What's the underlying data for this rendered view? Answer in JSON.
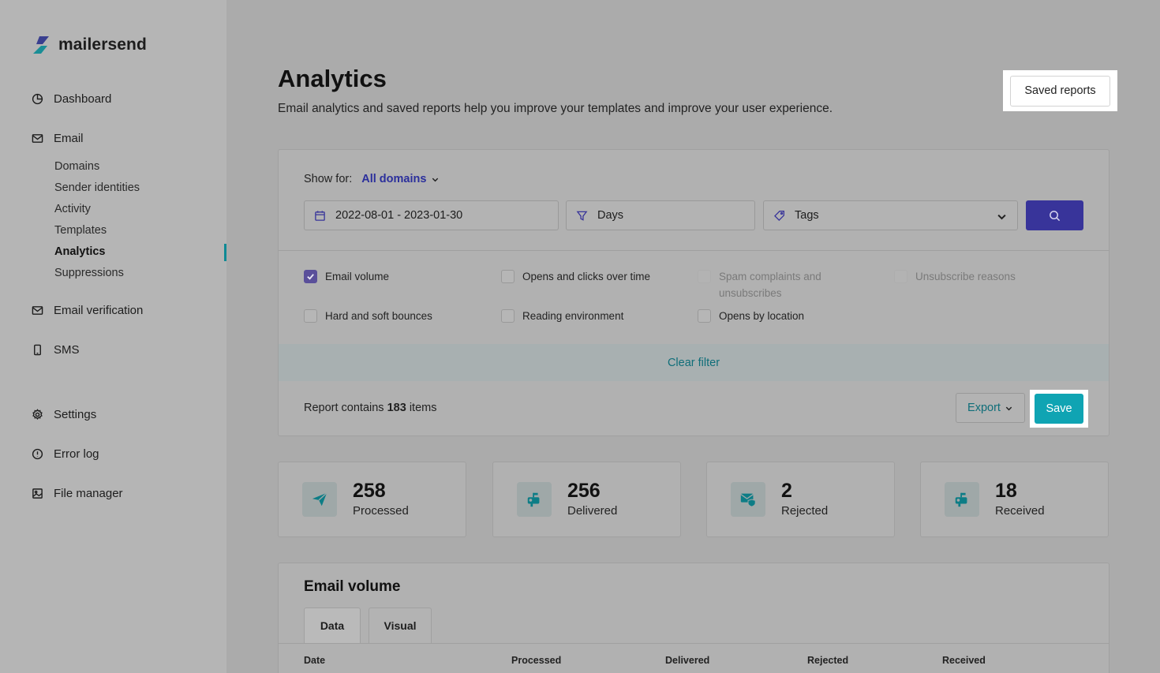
{
  "brand": {
    "name": "mailersend",
    "accent": "#0fa4b3",
    "primary": "#38349a"
  },
  "sidebar": {
    "nav": [
      {
        "label": "Dashboard",
        "icon": "dashboard-icon"
      },
      {
        "label": "Email",
        "icon": "email-icon"
      },
      {
        "label": "Email verification",
        "icon": "email-verification-icon"
      },
      {
        "label": "SMS",
        "icon": "phone-icon"
      },
      {
        "label": "Settings",
        "icon": "gear-icon"
      },
      {
        "label": "Error log",
        "icon": "alert-circle-icon"
      },
      {
        "label": "File manager",
        "icon": "image-icon"
      }
    ],
    "email_sub": [
      "Domains",
      "Sender identities",
      "Activity",
      "Templates",
      "Analytics",
      "Suppressions"
    ],
    "active": "Analytics"
  },
  "header": {
    "title": "Analytics",
    "subtitle": "Email analytics and saved reports help you improve your templates and improve your user experience.",
    "saved_reports_label": "Saved reports"
  },
  "filters": {
    "show_for_label": "Show for:",
    "domain": "All domains",
    "date_range": "2022-08-01 - 2023-01-30",
    "group_by": "Days",
    "tags_placeholder": "Tags",
    "options": [
      {
        "label": "Email volume",
        "checked": true,
        "disabled": false
      },
      {
        "label": "Opens and clicks over time",
        "checked": false,
        "disabled": false
      },
      {
        "label": "Spam complaints and unsubscribes",
        "checked": false,
        "disabled": true
      },
      {
        "label": "Unsubscribe reasons",
        "checked": false,
        "disabled": true
      },
      {
        "label": "Hard and soft bounces",
        "checked": false,
        "disabled": false
      },
      {
        "label": "Reading environment",
        "checked": false,
        "disabled": false
      },
      {
        "label": "Opens by location",
        "checked": false,
        "disabled": false
      }
    ],
    "clear_label": "Clear filter"
  },
  "report": {
    "prefix": "Report contains",
    "count": "183",
    "suffix": "items",
    "export_label": "Export",
    "save_label": "Save"
  },
  "stats": [
    {
      "value": "258",
      "label": "Processed",
      "icon": "paper-plane-icon"
    },
    {
      "value": "256",
      "label": "Delivered",
      "icon": "mailbox-icon"
    },
    {
      "value": "2",
      "label": "Rejected",
      "icon": "mail-shield-icon"
    },
    {
      "value": "18",
      "label": "Received",
      "icon": "mailbox-icon"
    }
  ],
  "email_volume": {
    "title": "Email volume",
    "tabs": [
      "Data",
      "Visual"
    ],
    "columns": [
      "Date",
      "Processed",
      "Delivered",
      "Rejected",
      "Received"
    ]
  }
}
